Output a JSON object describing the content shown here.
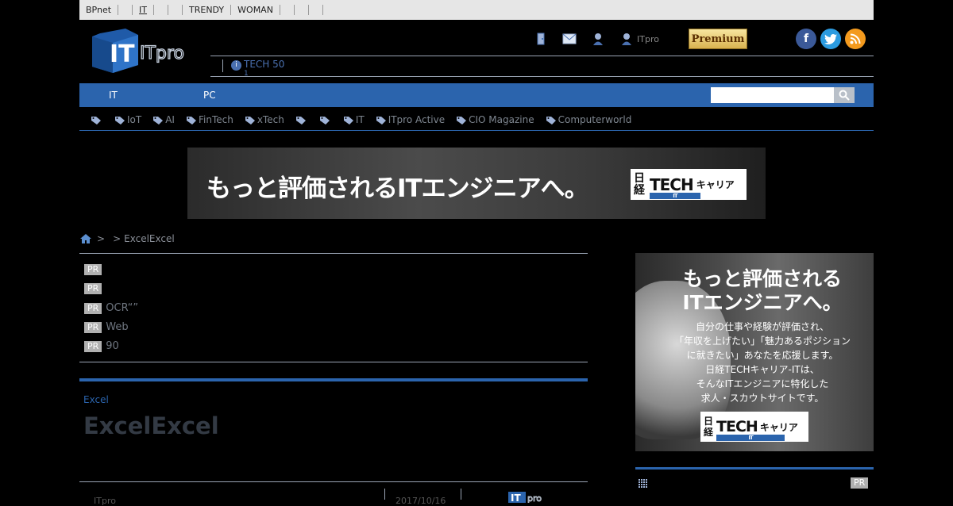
{
  "topbar": {
    "items": [
      {
        "label": "BPnet"
      },
      {
        "label": ""
      },
      {
        "label": "IT",
        "selected": true
      },
      {
        "label": ""
      },
      {
        "label": ""
      },
      {
        "label": "TRENDY"
      },
      {
        "label": "WOMAN"
      },
      {
        "label": ""
      },
      {
        "label": ""
      },
      {
        "label": ""
      }
    ]
  },
  "header": {
    "logo_text": "ITpro",
    "user_label": "ITpro",
    "premium_label": "Premium",
    "news": {
      "text": "TECH 50",
      "sub": "1"
    }
  },
  "nav": {
    "items": [
      "IT",
      "PC"
    ]
  },
  "search": {
    "placeholder": ""
  },
  "tags": [
    "",
    "IoT",
    "AI",
    "FinTech",
    "xTech",
    "",
    "",
    "IT",
    "ITpro Active",
    "CIO Magazine",
    "Computerworld"
  ],
  "banner": {
    "headline": "もっと評価されるITエンジニアへ。",
    "logo_left": "日経",
    "logo_mid": "TECH",
    "logo_right": "キャリア",
    "logo_sub": "IT"
  },
  "breadcrumb": {
    "sep1": ">",
    "sep2": ">",
    "current": "ExcelExcel"
  },
  "pr_items": [
    {
      "badge": "PR",
      "text": ""
    },
    {
      "badge": "PR",
      "text": ""
    },
    {
      "badge": "PR",
      "text": "OCR“”"
    },
    {
      "badge": "PR",
      "text": "Web"
    },
    {
      "badge": "PR",
      "text": "90"
    }
  ],
  "article": {
    "category": "Excel",
    "title": "ExcelExcel",
    "source": "ITpro",
    "date": "2017/10/16"
  },
  "side_ad": {
    "headline_1": "もっと評価される",
    "headline_2": "ITエンジニアへ。",
    "body": [
      "自分の仕事や経験が評価され、",
      "「年収を上げたい」「魅力あるポジション",
      "に就きたい」あなたを応援します。",
      "日経TECHキャリア-ITは、",
      "そんなITエンジニアに特化した",
      "求人・スカウトサイトです。"
    ],
    "logo_left_1": "日",
    "logo_left_2": "経",
    "logo_mid": "TECH",
    "logo_right": "キャリア",
    "logo_sub": "IT"
  },
  "side_box": {
    "badge": "PR"
  },
  "colors": {
    "accent": "#2b64ad",
    "topbar": "#e6e6e6",
    "background": "#000000"
  }
}
